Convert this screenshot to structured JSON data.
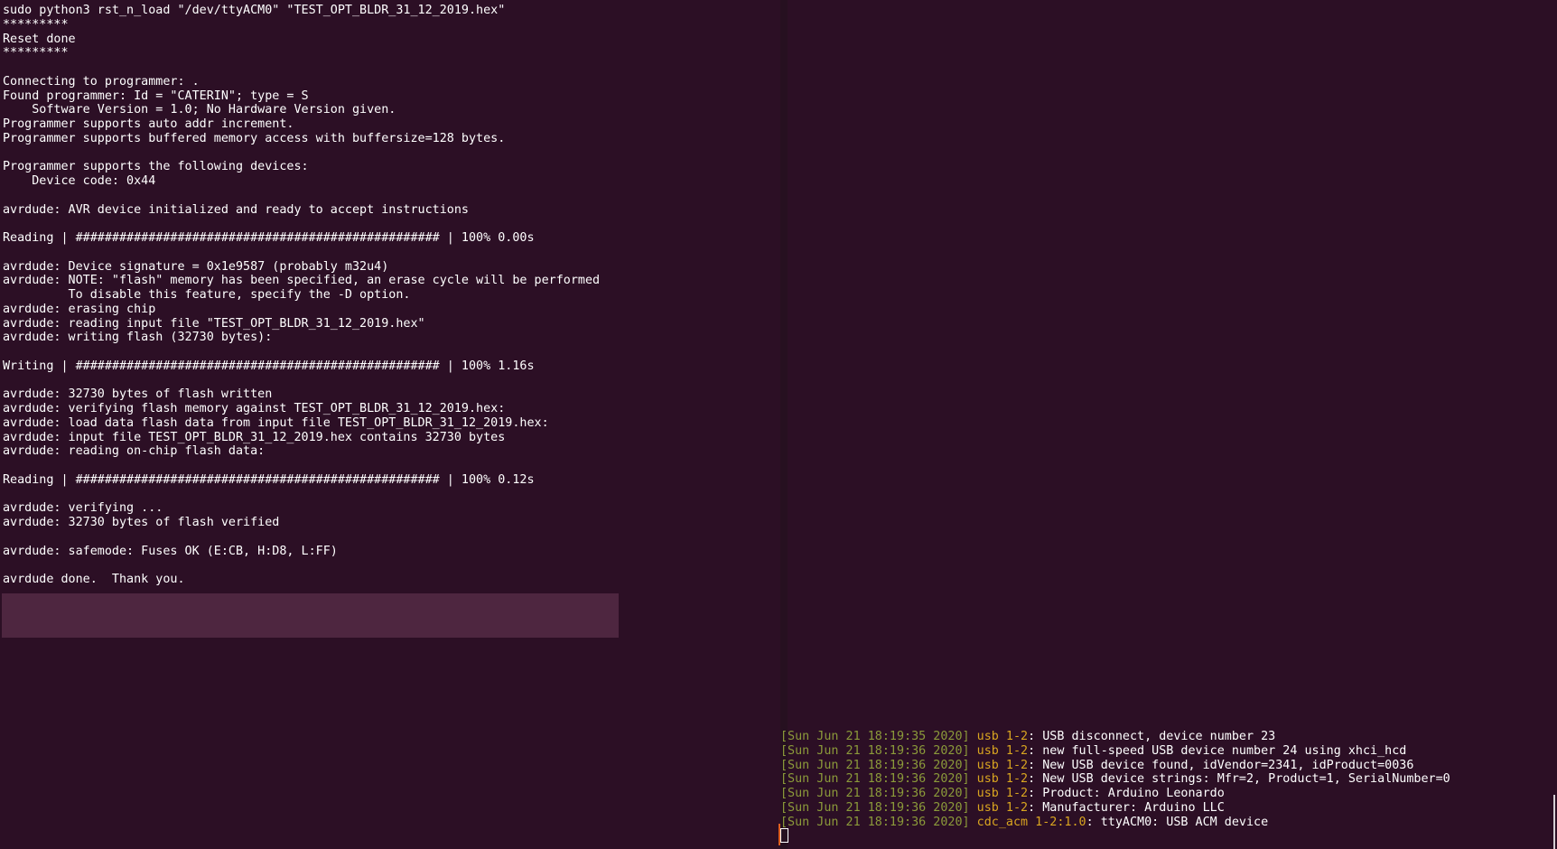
{
  "terminal_left": {
    "lines": [
      "sudo python3 rst_n_load \"/dev/ttyACM0\" \"TEST_OPT_BLDR_31_12_2019.hex\"",
      "*********",
      "Reset done",
      "*********",
      "",
      "Connecting to programmer: .",
      "Found programmer: Id = \"CATERIN\"; type = S",
      "    Software Version = 1.0; No Hardware Version given.",
      "Programmer supports auto addr increment.",
      "Programmer supports buffered memory access with buffersize=128 bytes.",
      "",
      "Programmer supports the following devices:",
      "    Device code: 0x44",
      "",
      "avrdude: AVR device initialized and ready to accept instructions",
      "",
      "Reading | ################################################## | 100% 0.00s",
      "",
      "avrdude: Device signature = 0x1e9587 (probably m32u4)",
      "avrdude: NOTE: \"flash\" memory has been specified, an erase cycle will be performed",
      "         To disable this feature, specify the -D option.",
      "avrdude: erasing chip",
      "avrdude: reading input file \"TEST_OPT_BLDR_31_12_2019.hex\"",
      "avrdude: writing flash (32730 bytes):",
      "",
      "Writing | ################################################## | 100% 1.16s",
      "",
      "avrdude: 32730 bytes of flash written",
      "avrdude: verifying flash memory against TEST_OPT_BLDR_31_12_2019.hex:",
      "avrdude: load data flash data from input file TEST_OPT_BLDR_31_12_2019.hex:",
      "avrdude: input file TEST_OPT_BLDR_31_12_2019.hex contains 32730 bytes",
      "avrdude: reading on-chip flash data:",
      "",
      "Reading | ################################################## | 100% 0.12s",
      "",
      "avrdude: verifying ...",
      "avrdude: 32730 bytes of flash verified",
      "",
      "avrdude: safemode: Fuses OK (E:CB, H:D8, L:FF)",
      "",
      "avrdude done.  Thank you."
    ]
  },
  "terminal_right": {
    "log": [
      {
        "ts": "[Sun Jun 21 18:19:35 2020]",
        "dev": "usb 1-2",
        "msg": " USB disconnect, device number 23"
      },
      {
        "ts": "[Sun Jun 21 18:19:36 2020]",
        "dev": "usb 1-2",
        "msg": " new full-speed USB device number 24 using xhci_hcd"
      },
      {
        "ts": "[Sun Jun 21 18:19:36 2020]",
        "dev": "usb 1-2",
        "msg": " New USB device found, idVendor=2341, idProduct=0036"
      },
      {
        "ts": "[Sun Jun 21 18:19:36 2020]",
        "dev": "usb 1-2",
        "msg": " New USB device strings: Mfr=2, Product=1, SerialNumber=0"
      },
      {
        "ts": "[Sun Jun 21 18:19:36 2020]",
        "dev": "usb 1-2",
        "msg": " Product: Arduino Leonardo"
      },
      {
        "ts": "[Sun Jun 21 18:19:36 2020]",
        "dev": "usb 1-2",
        "msg": " Manufacturer: Arduino LLC"
      },
      {
        "ts": "[Sun Jun 21 18:19:36 2020]",
        "dev": "cdc_acm 1-2:1.0",
        "msg": " ttyACM0: USB ACM device"
      }
    ],
    "separator": ":"
  },
  "colors": {
    "background": "#2c0f25",
    "timestamp": "#8b9a3a",
    "device": "#d9a520",
    "text": "#ffffff",
    "selection": "#4e2640"
  }
}
